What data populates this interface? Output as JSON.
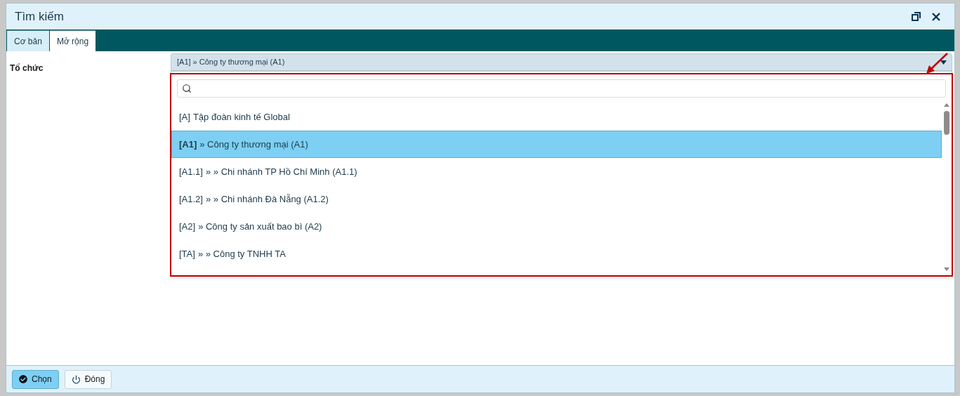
{
  "window": {
    "title": "Tìm kiếm"
  },
  "tabs": [
    {
      "label": "Cơ bản",
      "selected": false
    },
    {
      "label": "Mở rộng",
      "selected": true
    }
  ],
  "field": {
    "label": "Tổ chức",
    "value": "[A1] » Công ty thương mại (A1)"
  },
  "dropdown": {
    "items": [
      {
        "code": "[A]",
        "label": "Tập đoàn kinh tế Global",
        "selected": false
      },
      {
        "code": "[A1]",
        "label": "» Công ty thương mại (A1)",
        "selected": true
      },
      {
        "code": "[A1.1]",
        "label": "» » Chi nhánh TP Hồ Chí Minh (A1.1)",
        "selected": false
      },
      {
        "code": "[A1.2]",
        "label": "» » Chi nhánh Đà Nẵng (A1.2)",
        "selected": false
      },
      {
        "code": "[A2]",
        "label": "» Công ty sản xuất bao bì (A2)",
        "selected": false
      },
      {
        "code": "[TA]",
        "label": "» » Công ty TNHH TA",
        "selected": false
      }
    ]
  },
  "buttons": [
    {
      "label": "Chọn",
      "kind": "primary"
    },
    {
      "label": "Đóng",
      "kind": "secondary"
    }
  ]
}
